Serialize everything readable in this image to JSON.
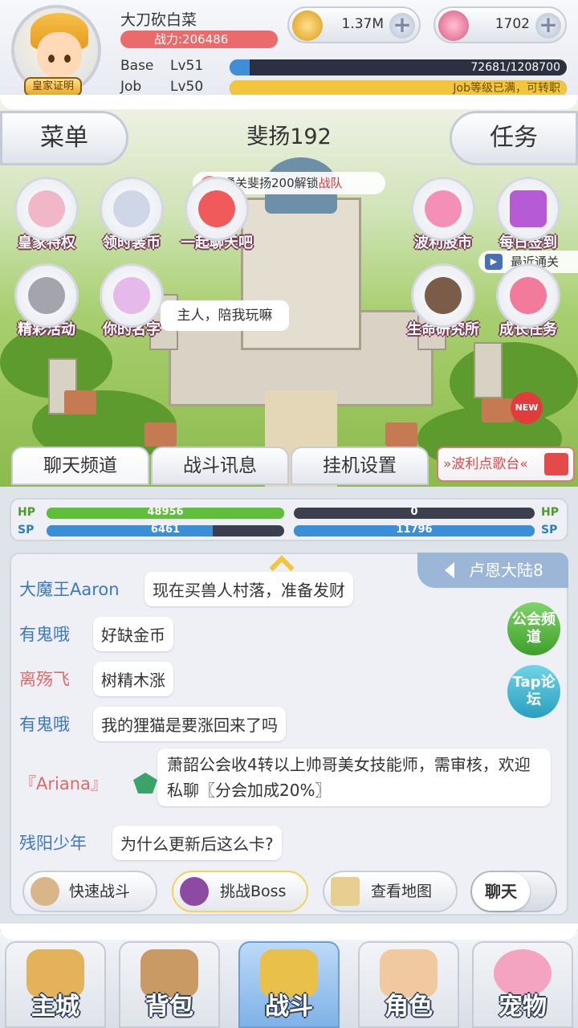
{
  "player": {
    "name": "大刀砍白菜",
    "badge": "皇家证明",
    "power": "战力:206486",
    "base_label": "Base",
    "base_level": "Lv51",
    "base_exp": "72681/1208700",
    "base_progress": 0.06,
    "job_label": "Job",
    "job_level": "Lv50",
    "job_exp": "Job等级已满，可转职",
    "job_progress": 1.0
  },
  "currency": {
    "zeny": "1.37M",
    "gems": "1702",
    "plus": "+"
  },
  "top_nav": {
    "menu": "菜单",
    "zone": "斐扬192",
    "task": "任务"
  },
  "notice": {
    "prefix": "通关斐扬200解锁",
    "highlight": "战队"
  },
  "features": {
    "royal": "皇家特权",
    "timed_gear": "领时装币",
    "chat_together": "一起聊天吧",
    "poring_stock": "波利股市",
    "daily_signin": "每日签到",
    "events": "精彩活动",
    "your_name": "你的名字",
    "life_research": "生命研究所",
    "growth_task": "成长任务",
    "recent_clear": "最近通关",
    "new_badge": "NEW"
  },
  "pet_bubble": "主人，陪我玩嘛",
  "chat_tabs": [
    "聊天频道",
    "战斗讯息",
    "挂机设置"
  ],
  "radio": "»波利点歌台«",
  "stats": {
    "hp_label": "HP",
    "sp_label": "SP",
    "player_hp": "48956",
    "player_sp": "6461",
    "enemy_hp": "0",
    "enemy_sp": "11796",
    "player_hp_fill": 1.0,
    "player_sp_fill": 0.7,
    "enemy_hp_fill": 0.0,
    "enemy_sp_fill": 1.0
  },
  "chat": {
    "region": "卢恩大陆8",
    "guild_channel": "公会频道",
    "tap_forum": "Tap论坛",
    "messages": [
      {
        "user": "大魔王Aaron",
        "text": "现在买兽人村落，准备发财",
        "color": "#3c78c4"
      },
      {
        "user": "有鬼哦",
        "text": "好缺金币",
        "color": "#3c78c4"
      },
      {
        "user": "离殇飞",
        "text": "树精木涨",
        "color": "#e06a6a"
      },
      {
        "user": "有鬼哦",
        "text": "我的狸猫是要涨回来了吗",
        "color": "#3c78c4"
      },
      {
        "user": "『Ariana』",
        "text": "萧韶公会收4转以上帅哥美女技能师，需审核，欢迎私聊〖分会加成20%〗",
        "color": "#e06a6a"
      },
      {
        "user": "残阳少年",
        "text": "为什么更新后这么卡?",
        "color": "#3c78c4"
      }
    ]
  },
  "actions": {
    "quick_battle": "快速战斗",
    "challenge_boss": "挑战Boss",
    "view_map": "查看地图",
    "chat_toggle": "聊天"
  },
  "bottom_nav": [
    "主城",
    "背包",
    "战斗",
    "角色",
    "宠物"
  ],
  "colors": {
    "hp_green": "#5fbf3a",
    "sp_blue": "#3b8fd6",
    "exp_blue": "#3f8fd8",
    "job_yellow": "#f3c53c",
    "power_red": "#ea6b6b",
    "active_nav": "#7fb2e6"
  }
}
